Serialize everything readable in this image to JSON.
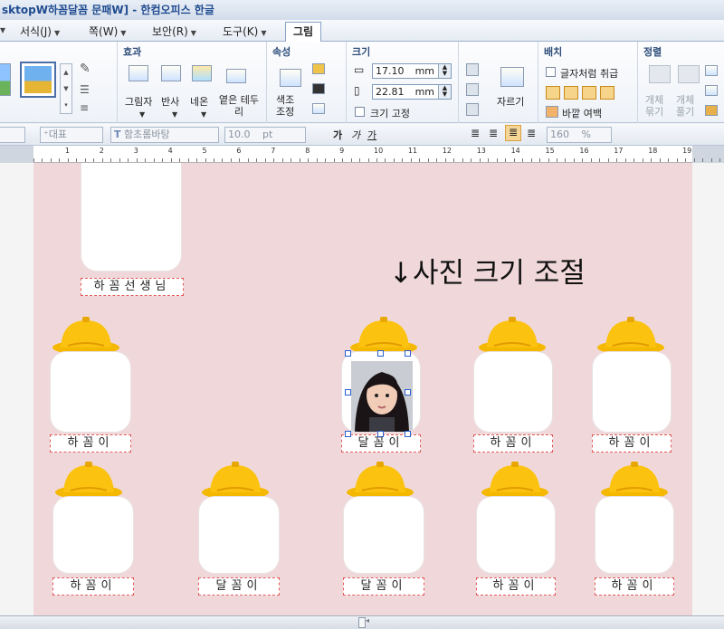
{
  "titlebar": {
    "text": "sktopW하꼼달꼼 문패W] - 한컴오피스 한글"
  },
  "menu": {
    "items": [
      "서식(J)",
      "쪽(W)",
      "보안(R)",
      "도구(K)"
    ],
    "active_tab": "그림"
  },
  "ribbon": {
    "effect": {
      "title": "효과",
      "shadow": "그림자",
      "reflect": "반사",
      "neon": "네온",
      "edge": "옅은 테두리"
    },
    "property": {
      "title": "속성",
      "color_adjust": "색조 조정"
    },
    "size": {
      "title": "크기",
      "width": "17.10",
      "height": "22.81",
      "unit": "mm",
      "fix_label": "크기 고정"
    },
    "crop": {
      "label": "자르기"
    },
    "arrange": {
      "title": "배치",
      "treat_as_char": "글자처럼 취급",
      "outer_margin": "바깥 여백"
    },
    "align": {
      "title": "정렬",
      "group": "개체 묶기",
      "ungroup": "개체 풀기"
    }
  },
  "format": {
    "style": "대표",
    "font": "함초롬바탕",
    "size": "10.0",
    "size_unit": "pt",
    "bold": "가",
    "italic": "가",
    "underline": "가",
    "linespacing": "160",
    "linespacing_unit": "%"
  },
  "ruler": {
    "numbers": [
      "1",
      "2",
      "3",
      "4",
      "5",
      "6",
      "7",
      "8",
      "9",
      "10",
      "11",
      "12",
      "13",
      "14",
      "15",
      "16",
      "17",
      "18",
      "19"
    ]
  },
  "document": {
    "guide_text": "↓사진 크기 조절",
    "teacher_label": "하꼼선생님",
    "row1": [
      "하꼼이",
      "달꼼이",
      "하꼼이",
      "하꼼이"
    ],
    "row2": [
      "하꼼이",
      "달꼼이",
      "달꼼이",
      "하꼼이",
      "하꼼이"
    ]
  }
}
